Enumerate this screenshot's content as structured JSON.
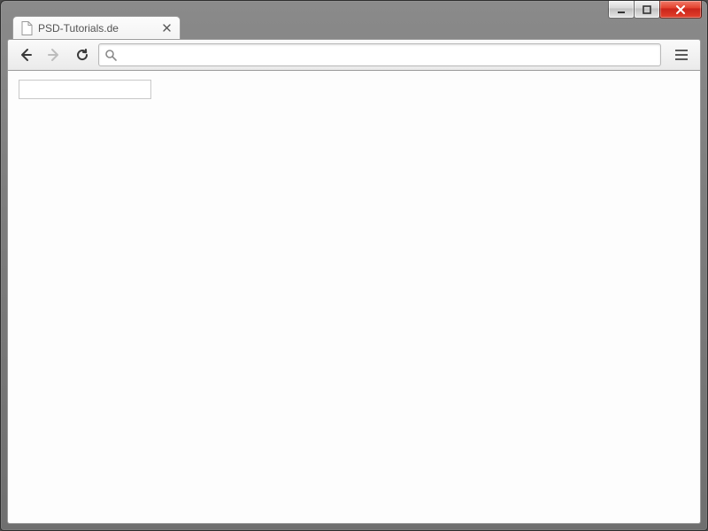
{
  "window_controls": {
    "minimize": "minimize",
    "maximize": "maximize",
    "close": "close"
  },
  "tab": {
    "title": "PSD-Tutorials.de"
  },
  "toolbar": {
    "address_value": "",
    "address_placeholder": ""
  },
  "page": {
    "input_value": ""
  }
}
